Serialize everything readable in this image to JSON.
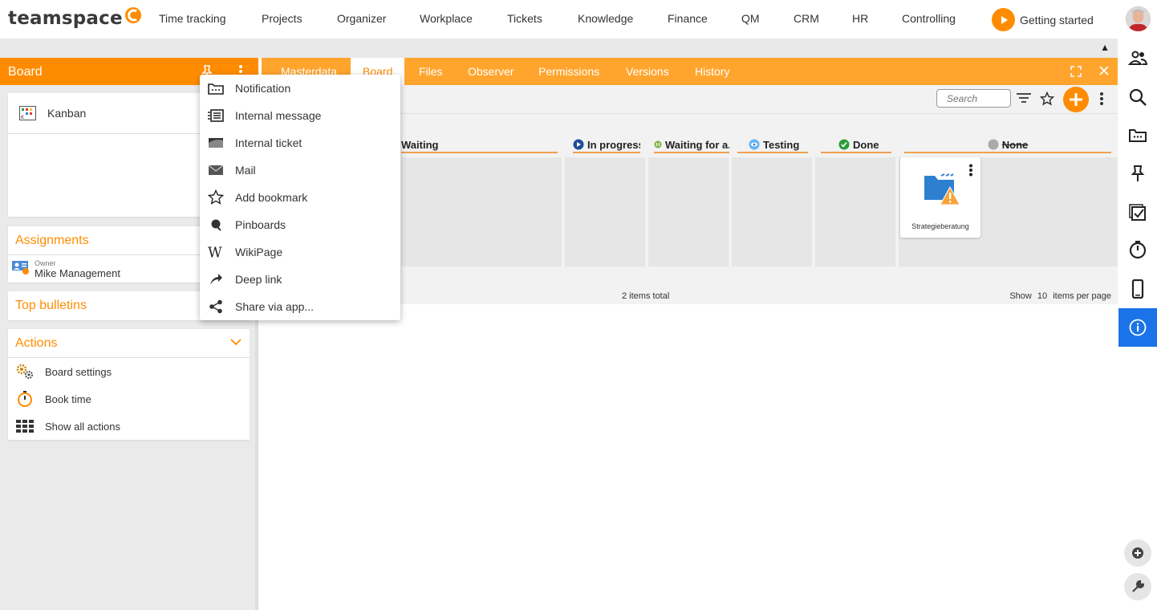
{
  "app": {
    "logo_text": "teamspace",
    "nav": [
      "Time tracking",
      "Projects",
      "Organizer",
      "Workplace",
      "Tickets",
      "Knowledge",
      "Finance",
      "QM",
      "CRM",
      "HR",
      "Controlling"
    ],
    "getting_started": "Getting started",
    "accent": "#ff8c00"
  },
  "left": {
    "board_title": "Board",
    "kanban_label": "Kanban",
    "assignments_title": "Assignments",
    "owner_label": "Owner",
    "owner_name": "Mike Management",
    "bulletins_title": "Top bulletins",
    "actions_title": "Actions",
    "actions": [
      "Board settings",
      "Book time",
      "Show all actions"
    ]
  },
  "tabs": [
    "Masterdata",
    "Board",
    "Files",
    "Observer",
    "Permissions",
    "Versions",
    "History"
  ],
  "toolbar": {
    "search_placeholder": "Search"
  },
  "board": {
    "columns": [
      "Waiting",
      "In progress",
      "Waiting for a...",
      "Testing",
      "Done",
      "None"
    ],
    "card_label": "Strategieberatung",
    "items_total": "2 items total",
    "show": "Show",
    "per_page_value": "10",
    "per_page_suffix": "items per page"
  },
  "menu": {
    "items": [
      "Notification",
      "Internal message",
      "Internal ticket",
      "Mail",
      "Add bookmark",
      "Pinboards",
      "WikiPage",
      "Deep link",
      "Share via app..."
    ]
  }
}
